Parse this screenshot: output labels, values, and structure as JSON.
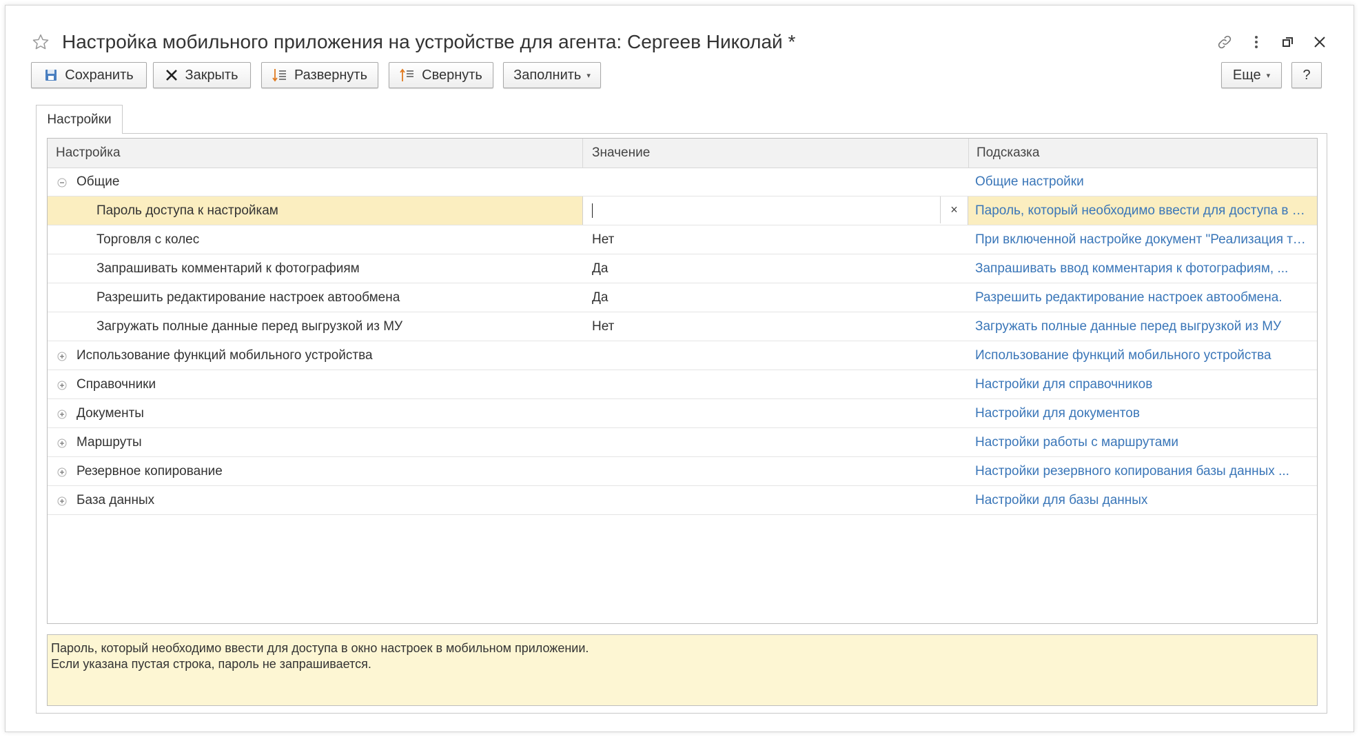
{
  "window": {
    "title": "Настройка мобильного приложения на устройстве для агента: Сергеев Николай *"
  },
  "toolbar": {
    "save_label": "Сохранить",
    "close_label": "Закрыть",
    "expand_label": "Развернуть",
    "collapse_label": "Свернуть",
    "fill_label": "Заполнить",
    "more_label": "Еще",
    "help_label": "?"
  },
  "tabs": [
    {
      "label": "Настройки"
    }
  ],
  "grid": {
    "columns": [
      "Настройка",
      "Значение",
      "Подсказка"
    ],
    "rows": [
      {
        "name": "Общие",
        "value": "",
        "hint": "Общие настройки"
      },
      {
        "name": "Пароль доступа к настройкам",
        "value": "",
        "hint": "Пароль, который необходимо ввести для доступа в окно настроек в мобильном приложении."
      },
      {
        "name": "Торговля с колес",
        "value": "Нет",
        "hint": "При включенной настройке документ \"Реализация товаров\""
      },
      {
        "name": "Запрашивать комментарий к фотографиям",
        "value": "Да",
        "hint": "Запрашивать ввод комментария к фотографиям, ..."
      },
      {
        "name": "Разрешить редактирование настроек автообмена",
        "value": "Да",
        "hint": "Разрешить редактирование настроек автообмена."
      },
      {
        "name": "Загружать полные данные перед выгрузкой из МУ",
        "value": "Нет",
        "hint": "Загружать полные данные перед выгрузкой из МУ"
      },
      {
        "name": "Использование функций мобильного устройства",
        "value": "",
        "hint": "Использование функций мобильного устройства"
      },
      {
        "name": "Справочники",
        "value": "",
        "hint": "Настройки для справочников"
      },
      {
        "name": "Документы",
        "value": "",
        "hint": "Настройки для документов"
      },
      {
        "name": "Маршруты",
        "value": "",
        "hint": "Настройки работы с маршрутами"
      },
      {
        "name": "Резервное копирование",
        "value": "",
        "hint": "Настройки резервного копирования базы данных ..."
      },
      {
        "name": "База данных",
        "value": "",
        "hint": "Настройки для базы данных"
      }
    ]
  },
  "hint_panel": {
    "line1": "Пароль, который необходимо ввести для доступа в окно настроек в мобильном приложении.",
    "line2": "Если указана пустая строка, пароль не запрашивается."
  },
  "colors": {
    "link": "#3a76b8",
    "selected_row": "#fbeec0",
    "hint_panel_bg": "#fdf6d3",
    "header_bg": "#f2f2f2"
  },
  "icons": [
    "star-icon",
    "link-icon",
    "more-vertical-icon",
    "restore-window-icon",
    "close-window-icon",
    "save-icon",
    "close-x-icon",
    "expand-tree-icon",
    "collapse-tree-icon",
    "tree-collapse-minus-icon",
    "tree-expand-plus-icon",
    "clear-x-icon"
  ]
}
